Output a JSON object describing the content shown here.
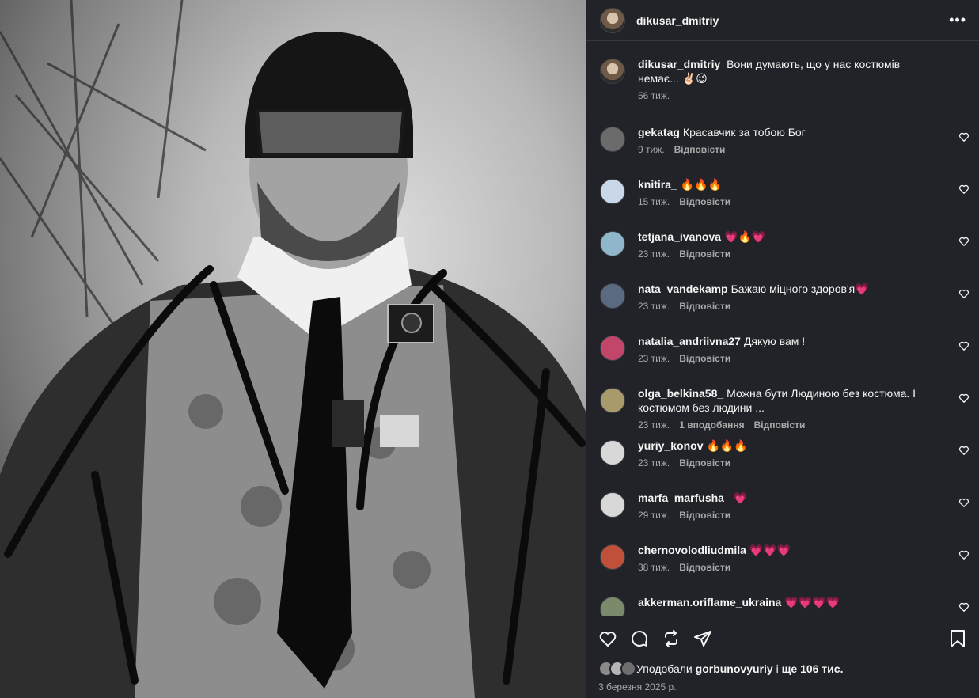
{
  "post": {
    "author": "dikusar_dmitriy",
    "more_icon": "more-horizontal-icon",
    "photo_description_icon": "post-photo",
    "caption": {
      "user": "dikusar_dmitriy",
      "text": "Вони думають, що у нас костюмів немає... ✌🏻😉",
      "time": "56 тиж."
    },
    "comments": [
      {
        "user": "gekatag",
        "text": "Красавчик за тобою Бог",
        "time": "9 тиж.",
        "reply": "Відповісти",
        "avatar_color": "#6b6b6b"
      },
      {
        "user": "knitira_",
        "text": "🔥🔥🔥",
        "time": "15 тиж.",
        "reply": "Відповісти",
        "avatar_color": "#c9d8e8"
      },
      {
        "user": "tetjana_ivanova",
        "text": "💗🔥💗",
        "time": "23 тиж.",
        "reply": "Відповісти",
        "avatar_color": "#8fb7c9"
      },
      {
        "user": "nata_vandekamp",
        "text": "Бажаю міцного здоров'я💗",
        "time": "23 тиж.",
        "reply": "Відповісти",
        "avatar_color": "#5a6a80"
      },
      {
        "user": "natalia_andriivna27",
        "text": "Дякую вам !",
        "time": "23 тиж.",
        "reply": "Відповісти",
        "avatar_color": "#c2456a"
      },
      {
        "user": "olga_belkina58_",
        "text": "Можна бути Людиною без костюма. І костюмом без людини ...",
        "time": "23 тиж.",
        "likes": "1 вподобання",
        "reply": "Відповісти",
        "avatar_color": "#a89a6a"
      },
      {
        "user": "yuriy_konov",
        "text": "🔥🔥🔥",
        "time": "23 тиж.",
        "reply": "Відповісти",
        "avatar_color": "#d8d8d8"
      },
      {
        "user": "marfa_marfusha_",
        "text": "💗",
        "time": "29 тиж.",
        "reply": "Відповісти",
        "avatar_color": "#d8d8d8"
      },
      {
        "user": "chernovolodliudmila",
        "text": "💗💗💗",
        "time": "38 тиж.",
        "reply": "Відповісти",
        "avatar_color": "#c0503a"
      },
      {
        "user": "akkerman.oriflame_ukraina",
        "text": "💗💗💗💗",
        "time": "",
        "reply": "",
        "avatar_color": "#7a8a6a"
      }
    ],
    "actions": {
      "like_icon": "heart-icon",
      "comment_icon": "comment-icon",
      "repost_icon": "repost-icon",
      "share_icon": "share-icon",
      "save_icon": "bookmark-icon"
    },
    "likes": {
      "prefix": "Уподобали",
      "user": "gorbunovyuriy",
      "connector": "і",
      "count": "ще 106 тис."
    },
    "date": "3 березня 2025 р."
  }
}
